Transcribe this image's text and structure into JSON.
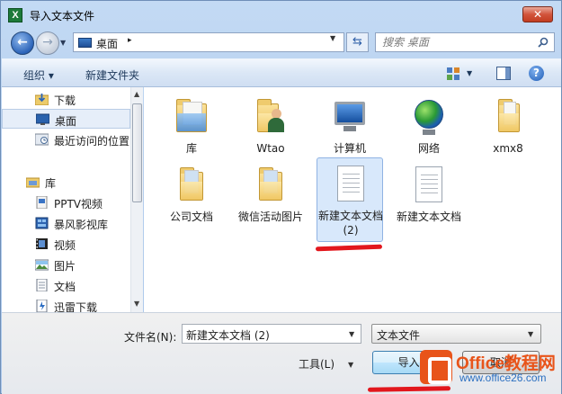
{
  "window": {
    "title": "导入文本文件",
    "close_label": "✕"
  },
  "address": {
    "location": "桌面",
    "separator": "▸"
  },
  "search": {
    "placeholder": "搜索 桌面"
  },
  "toolbar": {
    "organize_label": "组织 ▾",
    "new_folder_label": "新建文件夹",
    "help_label": "?"
  },
  "navigation": {
    "items": [
      {
        "label": "下载",
        "icon": "download-folder-icon"
      },
      {
        "label": "桌面",
        "icon": "desktop-icon",
        "selected": true
      },
      {
        "label": "最近访问的位置",
        "icon": "recent-places-icon"
      },
      {
        "label": "库",
        "icon": "libraries-icon",
        "is_library_root": true
      },
      {
        "label": "PPTV视频",
        "icon": "video-folder-icon"
      },
      {
        "label": "暴风影视库",
        "icon": "video-library-icon"
      },
      {
        "label": "视频",
        "icon": "videos-icon"
      },
      {
        "label": "图片",
        "icon": "pictures-icon"
      },
      {
        "label": "文档",
        "icon": "documents-icon"
      },
      {
        "label": "迅雷下载",
        "icon": "thunder-download-icon"
      }
    ]
  },
  "files": [
    {
      "label": "库",
      "type": "library-folder"
    },
    {
      "label": "Wtao",
      "type": "user-folder"
    },
    {
      "label": "计算机",
      "type": "computer"
    },
    {
      "label": "网络",
      "type": "network"
    },
    {
      "label": "xmx8",
      "type": "folder"
    },
    {
      "label": "公司文档",
      "type": "folder"
    },
    {
      "label": "微信活动图片",
      "type": "folder"
    },
    {
      "label": "新建文本文档 (2)",
      "type": "text-document",
      "selected": true
    },
    {
      "label": "新建文本文档",
      "type": "text-document"
    }
  ],
  "bottom": {
    "filename_label": "文件名(N):",
    "filename_value": "新建文本文档 (2)",
    "filetype_value": "文本文件",
    "tools_label": "工具(L)",
    "import_label": "导入(",
    "cancel_label": "取消"
  },
  "watermark": {
    "title": "Office教程网",
    "url": "www.office26.com"
  },
  "colors": {
    "accent": "#2c64b9",
    "highlight": "#e2171d",
    "watermark": "#e8541a"
  }
}
